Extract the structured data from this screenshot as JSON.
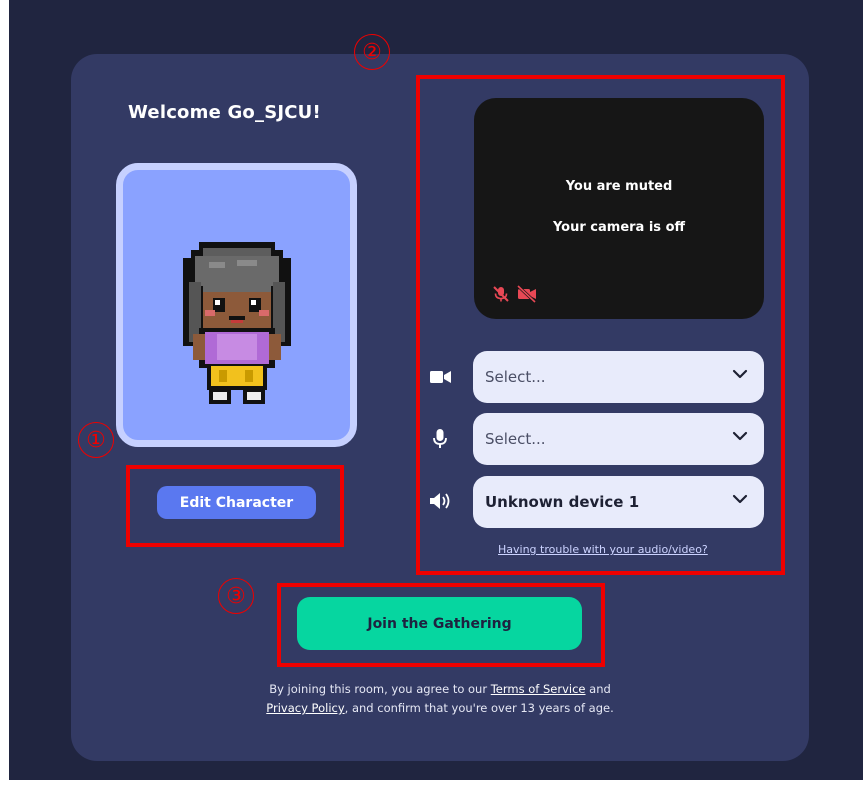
{
  "welcome": {
    "title": "Welcome Go_SJCU!"
  },
  "avatar": {
    "edit_label": "Edit Character"
  },
  "av_preview": {
    "muted_text": "You are muted",
    "camera_text": "Your camera is off"
  },
  "devices": {
    "camera": {
      "value": "Select...",
      "icon": "video-camera-icon"
    },
    "microphone": {
      "value": "Select...",
      "icon": "microphone-icon"
    },
    "speaker": {
      "value": "Unknown device 1",
      "icon": "speaker-icon"
    }
  },
  "trouble_link": "Having trouble with your audio/video?",
  "join_label": "Join the Gathering",
  "legal": {
    "prefix": "By joining this room, you agree to our ",
    "terms": "Terms of Service",
    "mid": " and",
    "privacy": "Privacy Policy",
    "suffix": ", and confirm that you're over 13 years of age."
  },
  "annotations": [
    "①",
    "②",
    "③"
  ],
  "colors": {
    "background": "#202540",
    "card": "#333a64",
    "accent_blue": "#5a78f0",
    "join_green": "#06d6a0",
    "muted_red": "#e84855",
    "annotation_red": "#ee0000"
  }
}
